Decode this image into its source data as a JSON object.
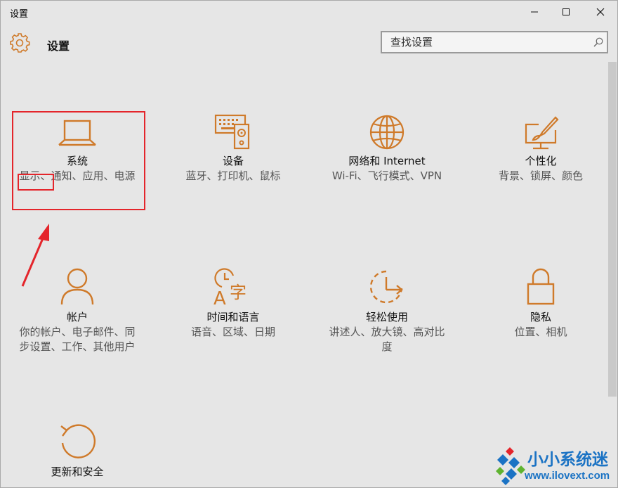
{
  "window": {
    "title": "设置",
    "minimize_glyph": "—",
    "maximize_glyph": "☐",
    "close_glyph": "✕"
  },
  "header": {
    "icon": "gear-icon",
    "title": "设置"
  },
  "search": {
    "placeholder": "查找设置",
    "icon": "search-icon"
  },
  "accent_color": "#cf7a2a",
  "highlight_color": "#e4252b",
  "tiles": [
    {
      "icon": "laptop-icon",
      "title": "系统",
      "desc": "显示、通知、应用、电源"
    },
    {
      "icon": "devices-icon",
      "title": "设备",
      "desc": "蓝牙、打印机、鼠标"
    },
    {
      "icon": "globe-icon",
      "title": "网络和 Internet",
      "desc": "Wi-Fi、飞行模式、VPN"
    },
    {
      "icon": "personalization-icon",
      "title": "个性化",
      "desc": "背景、锁屏、颜色"
    },
    {
      "icon": "person-icon",
      "title": "帐户",
      "desc": "你的帐户、电子邮件、同步设置、工作、其他用户"
    },
    {
      "icon": "time-language-icon",
      "title": "时间和语言",
      "desc": "语音、区域、日期"
    },
    {
      "icon": "ease-of-access-icon",
      "title": "轻松使用",
      "desc": "讲述人、放大镜、高对比度"
    },
    {
      "icon": "lock-icon",
      "title": "隐私",
      "desc": "位置、相机"
    },
    {
      "icon": "update-icon",
      "title": "更新和安全",
      "desc": ""
    }
  ],
  "watermark": {
    "text": "小小系统迷",
    "url": "www.ilovext.com"
  }
}
